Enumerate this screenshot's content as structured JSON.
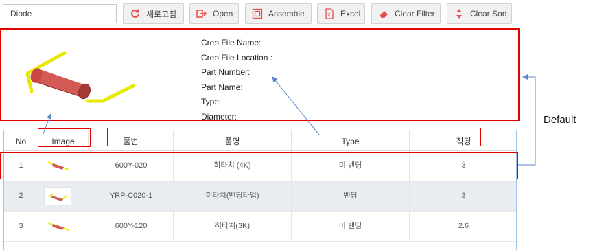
{
  "toolbar": {
    "search_value": "Diode",
    "buttons": {
      "refresh": "새로고침",
      "open": "Open",
      "assemble": "Assemble",
      "excel": "Excel",
      "clear_filter": "Clear Filter",
      "clear_sort": "Clear Sort"
    }
  },
  "detail": {
    "fields": [
      "Creo File Name:",
      "Creo File Location :",
      "Part Number:",
      "Part Name:",
      "Type:",
      "Diameter:"
    ]
  },
  "grid": {
    "columns": [
      "No",
      "Image",
      "품번",
      "품명",
      "Type",
      "직경"
    ],
    "rows": [
      {
        "no": "1",
        "part_no": "600Y-020",
        "name": "히타치 (4K)",
        "type": "미 밴딩",
        "diameter": "3"
      },
      {
        "no": "2",
        "part_no": "YRP-C020-1",
        "name": "히타치(밴딩타입)",
        "type": "밴딩",
        "diameter": "3"
      },
      {
        "no": "3",
        "part_no": "600Y-120",
        "name": "히타치(3K)",
        "type": "미 밴딩",
        "diameter": "2.6"
      }
    ]
  },
  "annotation": {
    "label": "Default",
    "color": "#e00000",
    "arrow_color": "#5b86c5"
  },
  "colors": {
    "refresh_icon": "#e05050",
    "open_icon": "#e05050",
    "part_body": "#d9534f",
    "part_lead": "#e8e800",
    "grid_border": "#9fc2e6"
  }
}
